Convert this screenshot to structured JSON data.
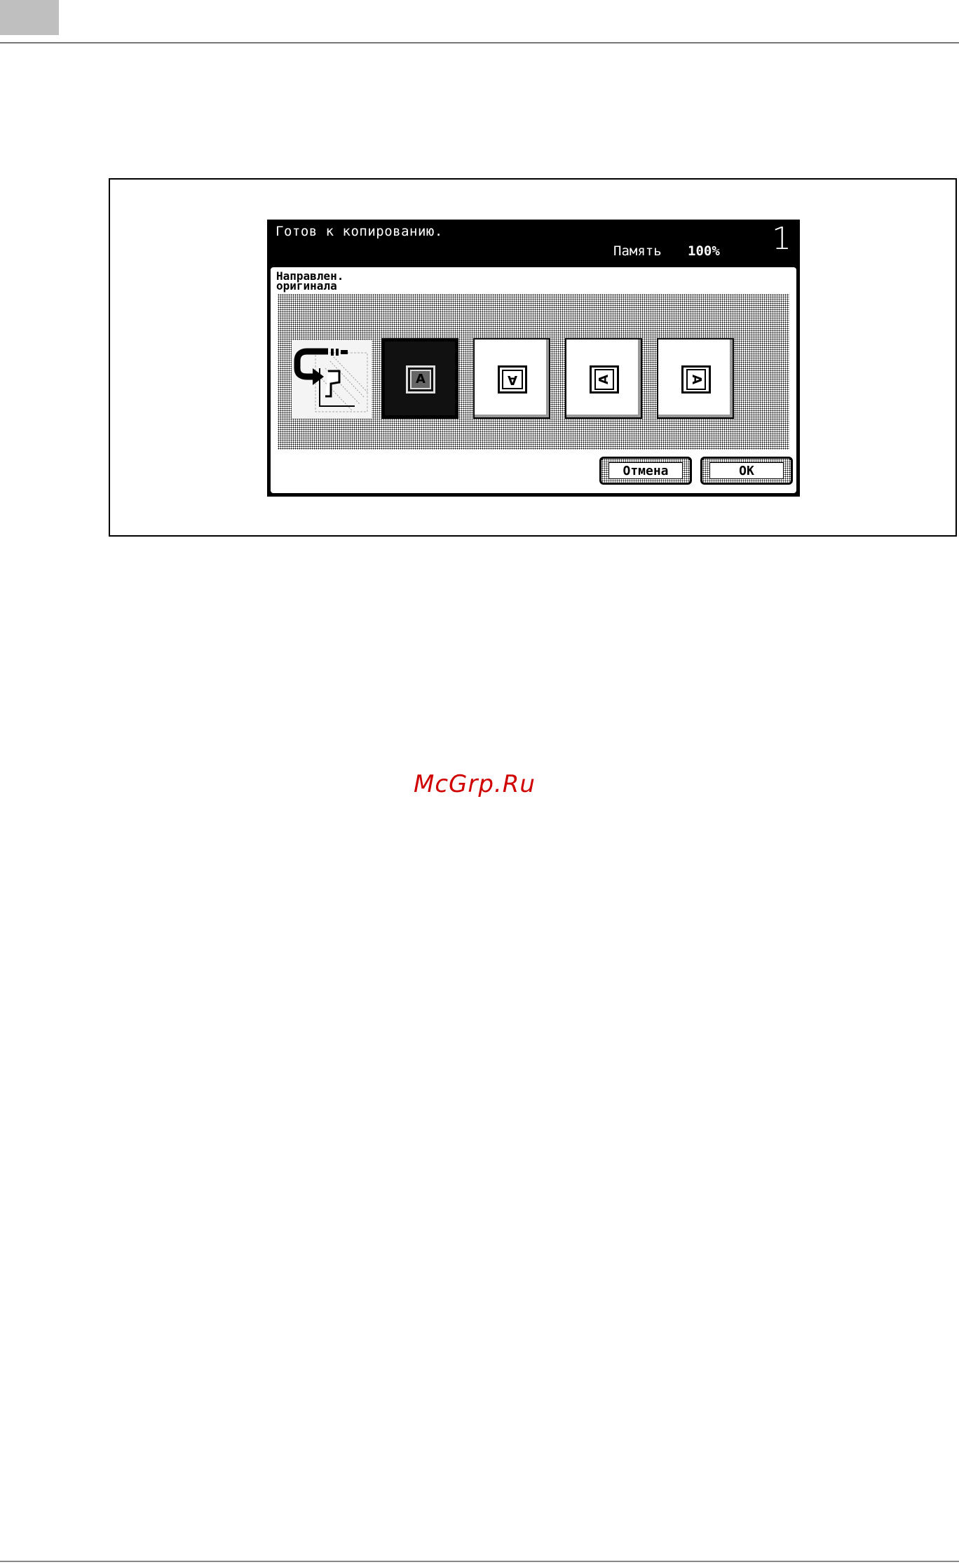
{
  "screen": {
    "status": {
      "message": "Готов к копированию.",
      "memory_label": "Память",
      "memory_value": "100%",
      "page_number": "1"
    },
    "panel": {
      "title": "Направлен.\nоригинала",
      "illustration_icon": "original-direction-illustration",
      "options": [
        {
          "glyph": "A",
          "orientation": "upright",
          "selected": true
        },
        {
          "glyph": "A",
          "orientation": "upside-down",
          "selected": false
        },
        {
          "glyph": "A",
          "orientation": "rotated-left",
          "selected": false
        },
        {
          "glyph": "A",
          "orientation": "rotated-right",
          "selected": false
        }
      ],
      "cancel_label": "Отмена",
      "ok_label": "OK"
    }
  },
  "watermark": "McGrp.Ru",
  "colors": {
    "screen_bg": "#000000",
    "watermark": "#d00000",
    "corner_tab": "#bfbfbf"
  }
}
